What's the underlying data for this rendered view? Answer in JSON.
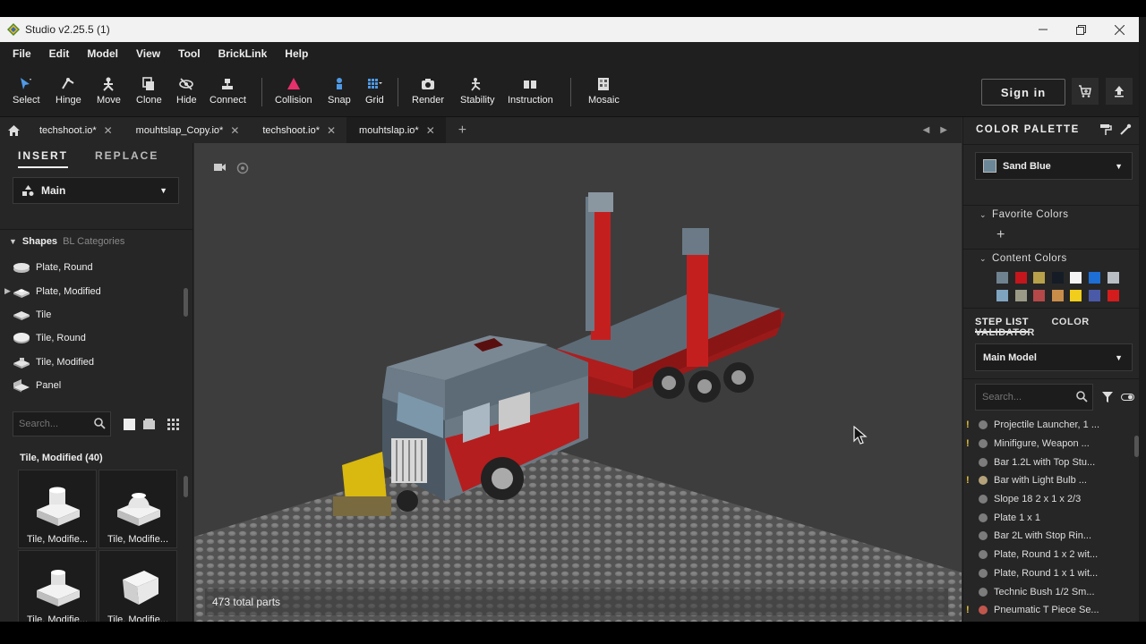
{
  "window": {
    "title": "Studio v2.25.5 (1)"
  },
  "menu": [
    "File",
    "Edit",
    "Model",
    "View",
    "Tool",
    "BrickLink",
    "Help"
  ],
  "toolbar": {
    "select": "Select",
    "hinge": "Hinge",
    "move": "Move",
    "clone": "Clone",
    "hide": "Hide",
    "connect": "Connect",
    "collision": "Collision",
    "snap": "Snap",
    "grid": "Grid",
    "render": "Render",
    "stability": "Stability",
    "instruction": "Instruction",
    "mosaic": "Mosaic",
    "sign_in": "Sign in"
  },
  "tabs": [
    {
      "label": "techshoot.io*"
    },
    {
      "label": "mouhtslap_Copy.io*"
    },
    {
      "label": "techshoot.io*"
    },
    {
      "label": "mouhtslap.io*"
    }
  ],
  "left_panel": {
    "tab_insert": "INSERT",
    "tab_replace": "REPLACE",
    "palette_select": "Main",
    "shapes_label": "Shapes",
    "bl_categories_label": "BL Categories",
    "shape_items": [
      {
        "label": "Plate, Round"
      },
      {
        "label": "Plate, Modified"
      },
      {
        "label": "Tile"
      },
      {
        "label": "Tile, Round"
      },
      {
        "label": "Tile, Modified"
      },
      {
        "label": "Panel"
      }
    ],
    "search_placeholder": "Search...",
    "group_title": "Tile, Modified (40)",
    "parts": [
      {
        "label": "Tile, Modifie..."
      },
      {
        "label": "Tile, Modifie..."
      },
      {
        "label": "Tile, Modifie..."
      },
      {
        "label": "Tile, Modifie..."
      }
    ]
  },
  "viewport": {
    "parts_count": "473 total parts"
  },
  "right_panel": {
    "title": "COLOR PALETTE",
    "selected_color": "Sand Blue",
    "favorite_colors": "Favorite Colors",
    "content_colors": "Content Colors",
    "content_swatches": [
      "#6f8290",
      "#c4161c",
      "#b7a14a",
      "#151c26",
      "#f4f4f4",
      "#1d6fd6",
      "#b9bec4",
      "#7fa4c0",
      "#9a9a86",
      "#b54848",
      "#c98d4a",
      "#f1cd1c",
      "#4a5aa8",
      "#d41c1c"
    ],
    "step_list_tab": "STEP LIST",
    "color_validator_tab": "COLOR VALIDATOR",
    "model_select": "Main Model",
    "search_placeholder": "Search...",
    "steps": [
      {
        "name": "Projectile Launcher, 1 ...",
        "warn": "!",
        "color": "#7c7c7c"
      },
      {
        "name": "Minifigure, Weapon ...",
        "warn": "!",
        "color": "#7c7c7c"
      },
      {
        "name": "Bar 1.2L with Top Stu...",
        "warn": "",
        "color": "#7c7c7c"
      },
      {
        "name": "Bar with Light Bulb ...",
        "warn": "!",
        "color": "#b5a27a"
      },
      {
        "name": "Slope 18 2 x 1 x 2/3",
        "warn": "",
        "color": "#7c7c7c"
      },
      {
        "name": "Plate 1 x 1",
        "warn": "",
        "color": "#7c7c7c"
      },
      {
        "name": "Bar   2L with Stop Rin...",
        "warn": "",
        "color": "#7c7c7c"
      },
      {
        "name": "Plate, Round 1 x 2 wit...",
        "warn": "",
        "color": "#7c7c7c"
      },
      {
        "name": "Plate, Round 1 x 1 wit...",
        "warn": "",
        "color": "#7c7c7c"
      },
      {
        "name": "Technic Bush 1/2 Sm...",
        "warn": "",
        "color": "#7c7c7c"
      },
      {
        "name": "Pneumatic T Piece Se...",
        "warn": "!",
        "color": "#c0564c"
      }
    ]
  }
}
